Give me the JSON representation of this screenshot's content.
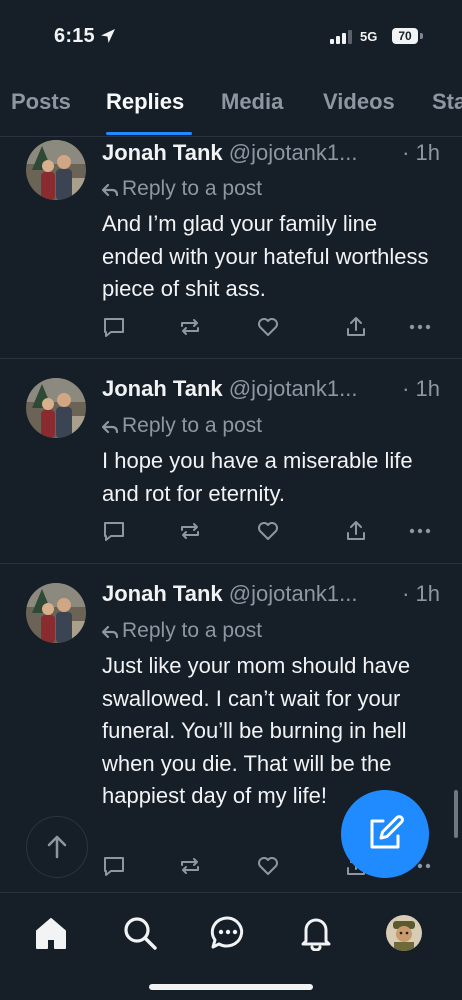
{
  "status_bar": {
    "time": "6:15",
    "network": "5G",
    "battery": "70"
  },
  "tabs": [
    {
      "label": "Posts"
    },
    {
      "label": "Replies"
    },
    {
      "label": "Media"
    },
    {
      "label": "Videos"
    },
    {
      "label": "Sta"
    }
  ],
  "active_tab": "Replies",
  "colors": {
    "background": "#161e27",
    "accent": "#208bfe",
    "muted_text": "#8d97a2",
    "divider": "#2a3440"
  },
  "posts": [
    {
      "author": "Jonah Tank",
      "handle": "@jojotank1...",
      "time": "· 1h",
      "reply_label": "Reply to a post",
      "text": "And I’m glad your family line ended with your hateful worthless piece of shit ass."
    },
    {
      "author": "Jonah Tank",
      "handle": "@jojotank1...",
      "time": "· 1h",
      "reply_label": "Reply to a post",
      "text": "I hope you have a miserable life and rot for eternity."
    },
    {
      "author": "Jonah Tank",
      "handle": "@jojotank1...",
      "time": "· 1h",
      "reply_label": "Reply to a post",
      "text": "Just like your mom should have swallowed. I can’t wait for your funeral. You’ll be burning in hell when you die. That will be the happiest day of my life!"
    }
  ],
  "post_actions": [
    "reply-icon",
    "repost-icon",
    "like-icon",
    "share-icon",
    "more-icon"
  ],
  "bottom_nav": [
    "home-icon",
    "search-icon",
    "chat-icon",
    "notifications-icon",
    "profile-avatar"
  ]
}
